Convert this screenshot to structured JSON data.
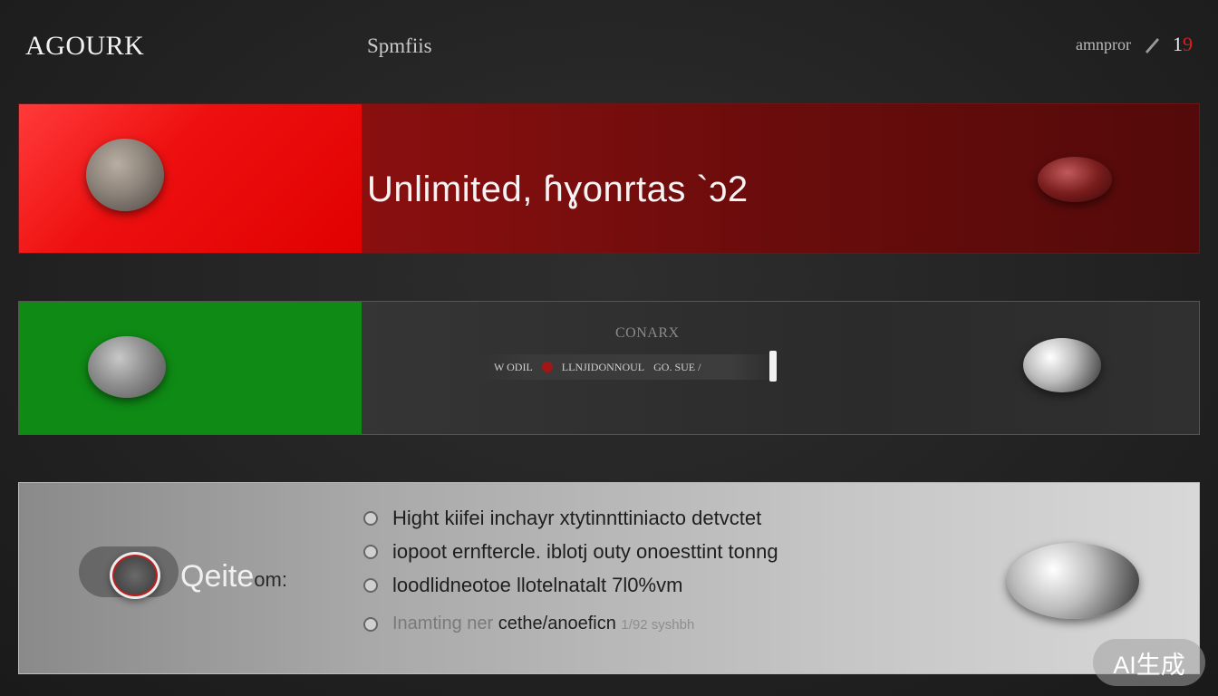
{
  "header": {
    "logo": "AGOURK",
    "nav_link": "Spmfiis",
    "right_label": "amnpror",
    "badge_main": "1",
    "badge_accent": "9"
  },
  "panel_red": {
    "headline": "Unlimited, ɦɣonrtas  `ɔ2",
    "accent_colors": [
      "#e00000",
      "#5a0e0e"
    ]
  },
  "panel_green": {
    "brand": "CONARX",
    "playbar": {
      "left_text": "W ODIL",
      "center_text": "LLNJIDONNOUL",
      "right_text": "GO. SUE /"
    },
    "accent_color": "#0f8a15"
  },
  "panel_gray": {
    "toggle_label": "Qeite",
    "toggle_suffix": "om:",
    "items": [
      "Hight kiifei inchayr xtytinnttiniacto detvctet",
      "iopoot ernftercle. iblotj outy onoesttint tonng",
      "loodlidneotoe llotelnatalt 7l0%vm"
    ],
    "last_item": {
      "soft": "Inamting ner",
      "strong": "cethe/anoeficn",
      "soft2": "1/92 syshbh"
    }
  },
  "watermark": "AI生成"
}
